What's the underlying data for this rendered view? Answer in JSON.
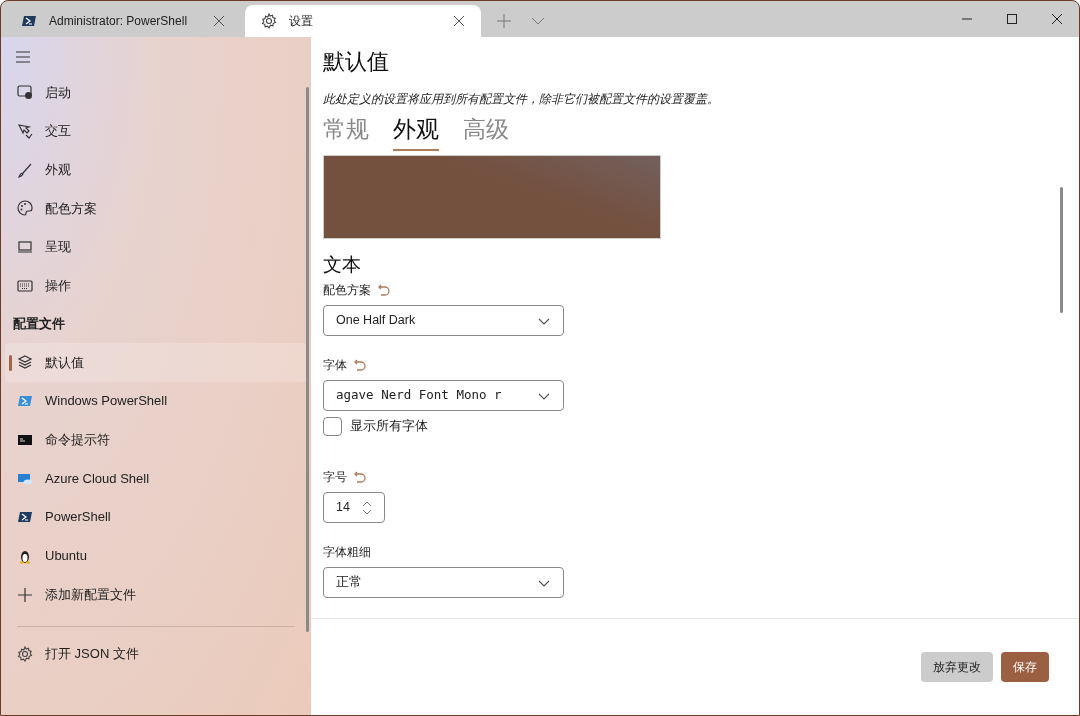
{
  "tabs": [
    {
      "label": "Administrator: PowerShell",
      "kind": "shell",
      "selected": false
    },
    {
      "label": "设置",
      "kind": "settings",
      "selected": true
    }
  ],
  "sidebar": {
    "items": [
      {
        "label": "启动",
        "kind": "launch",
        "selected": false
      },
      {
        "label": "交互",
        "kind": "interact",
        "selected": false
      },
      {
        "label": "外观",
        "kind": "brush",
        "selected": false
      },
      {
        "label": "配色方案",
        "kind": "palette",
        "selected": false
      },
      {
        "label": "呈现",
        "kind": "laptop",
        "selected": false
      },
      {
        "label": "操作",
        "kind": "keyboard",
        "selected": false
      }
    ],
    "section_title": "配置文件",
    "profiles": [
      {
        "label": "默认值",
        "kind": "layers",
        "selected": true
      },
      {
        "label": "Windows PowerShell",
        "kind": "ps-light",
        "selected": false
      },
      {
        "label": "命令提示符",
        "kind": "cmd",
        "selected": false
      },
      {
        "label": "Azure Cloud Shell",
        "kind": "azure",
        "selected": false
      },
      {
        "label": "PowerShell",
        "kind": "ps-dark",
        "selected": false
      },
      {
        "label": "Ubuntu",
        "kind": "penguin",
        "selected": false
      },
      {
        "label": "添加新配置文件",
        "kind": "plus",
        "selected": false
      }
    ],
    "footer_item": "打开 JSON 文件"
  },
  "page": {
    "title": "默认值",
    "description": "此处定义的设置将应用到所有配置文件，除非它们被配置文件的设置覆盖。",
    "tabs": [
      {
        "label": "常规",
        "selected": false
      },
      {
        "label": "外观",
        "selected": true
      },
      {
        "label": "高级",
        "selected": false
      }
    ],
    "section": "文本",
    "settings": [
      {
        "kind": "dropdown",
        "label": "配色方案",
        "reset": true,
        "value": "One Half Dark"
      },
      {
        "kind": "dropdown",
        "label": "字体",
        "reset": true,
        "value": "agave Nerd Font Mono r",
        "mono": true
      },
      {
        "kind": "checkbox",
        "label": "显示所有字体",
        "checked": false
      },
      {
        "kind": "number",
        "label": "字号",
        "reset": true,
        "value": "14"
      },
      {
        "kind": "dropdown",
        "label": "字体粗细",
        "reset": false,
        "value": "正常"
      }
    ]
  },
  "footer_buttons": [
    {
      "label": "放弃更改",
      "kind": "secondary"
    },
    {
      "label": "保存",
      "kind": "primary"
    }
  ]
}
